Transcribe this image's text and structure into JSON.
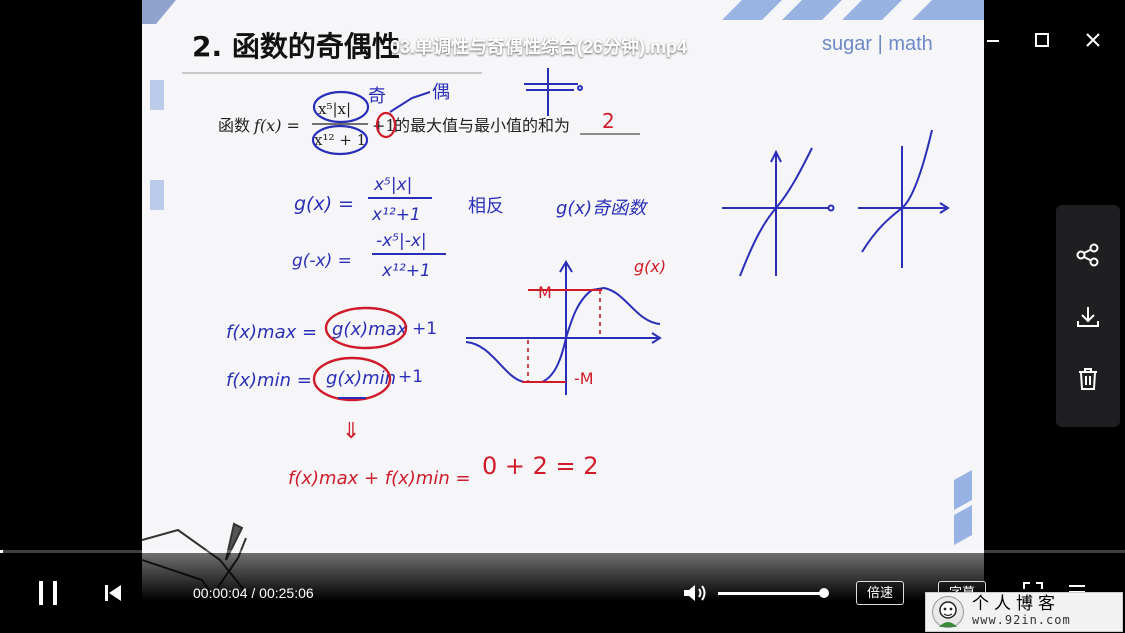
{
  "window": {
    "title": "03.单调性与奇偶性综合(26分钟).mp4",
    "minimize_glyph": "—",
    "maximize_glyph": "☐",
    "close_glyph": "✕"
  },
  "slide": {
    "heading": "2. 函数的奇偶性",
    "brand": "sugar | math",
    "problem_prefix": "函数",
    "problem_fx": "f(x) =",
    "numerator": "x⁵|x|",
    "denominator": "x¹² + 1",
    "plus_one": "+1",
    "problem_suffix": "的最大值与最小值的和为",
    "answer": "2",
    "annotations": {
      "odd": "奇",
      "even": "偶",
      "g_def": "g(x) =",
      "g_num": "x⁵|x|",
      "g_den": "x¹²+1",
      "opposite": "相反",
      "g_odd": "g(x)奇函数",
      "g_neg_def": "g(-x) =",
      "g_neg_num": "-x⁵|-x|",
      "g_neg_den": "x¹²+1",
      "graph_label": "g(x)",
      "max_label": "M",
      "min_label": "-M",
      "fmax_left": "f(x)max =",
      "fmax_right": "g(x)max",
      "fmax_plus": "+1",
      "fmin_left": "f(x)min =",
      "fmin_right": "g(x)min",
      "fmin_plus": "+1",
      "implies": "⇓",
      "sum_left": "f(x)max + f(x)min =",
      "sum_right": "0 + 2 = 2"
    }
  },
  "player": {
    "current_time": "00:00:04",
    "separator": " / ",
    "total_time": "00:25:06",
    "progress": 0.003,
    "volume": 0.98,
    "speed_label": "倍速",
    "subtitle_label": "字幕"
  },
  "watermark": {
    "name": "个人博客",
    "url": "www.92in.com"
  },
  "colors": {
    "ink_blue": "#2b2fb8",
    "ink_red": "#d01b2a",
    "text_dark": "#222222",
    "panel_bg": "#1f1f21"
  },
  "icons": {
    "share": "share-icon",
    "download": "download-icon",
    "delete": "trash-icon",
    "pause": "pause-icon",
    "previous": "skip-previous-icon",
    "volume": "volume-icon",
    "fullscreen": "fullscreen-icon",
    "more": "menu-icon"
  }
}
